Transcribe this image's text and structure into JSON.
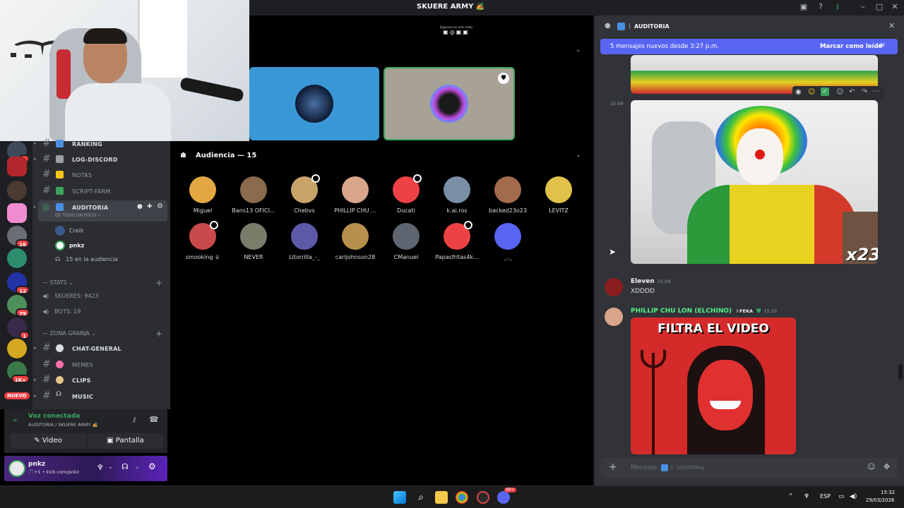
{
  "window": {
    "title": "SKUERE ARMY 🏕️"
  },
  "stage": {
    "banner_text": "Síguenos en más redes",
    "audience_label": "Audiencia — 15",
    "audience": [
      {
        "name": "Miguel",
        "color": "#e3a742",
        "muted": false
      },
      {
        "name": "Bans13 OFICI...",
        "color": "#8a6b4e",
        "muted": false
      },
      {
        "name": "Chebvs",
        "color": "#c9a46a",
        "muted": true
      },
      {
        "name": "PHILLIP CHU ...",
        "color": "#d9a58a",
        "muted": false
      },
      {
        "name": "Ducati",
        "color": "#ed4245",
        "muted": true
      },
      {
        "name": "k.ai.ros",
        "color": "#7a8fa6",
        "muted": false
      },
      {
        "name": "backed23o23",
        "color": "#a46a4e",
        "muted": false
      },
      {
        "name": "LEVITZ",
        "color": "#e1c14a",
        "muted": false
      },
      {
        "name": "smooking ♕",
        "color": "#c84a4a",
        "muted": true
      },
      {
        "name": "NEVER",
        "color": "#7c7c6a",
        "muted": false
      },
      {
        "name": "Litorrilla_-_",
        "color": "#5d5aa8",
        "muted": false
      },
      {
        "name": "carijohnson28",
        "color": "#b8904e",
        "muted": false
      },
      {
        "name": "CManuel",
        "color": "#5f6570",
        "muted": false
      },
      {
        "name": "Papasfritas4k...",
        "color": "#ed4245",
        "muted": true
      },
      {
        "name": "_._",
        "color": "#5865f2",
        "muted": false
      }
    ]
  },
  "channels": {
    "items": [
      {
        "label": "RANKING",
        "emoji_color": "#4a90e2"
      },
      {
        "label": "LOG-DISCORD",
        "emoji_color": "#9aa0a6"
      },
      {
        "label": "NOTAS",
        "emoji_color": "#f5c518"
      },
      {
        "label": "SCRIPT-FARM",
        "emoji_color": "#3ba55d"
      }
    ],
    "active_voice": {
      "label": "AUDITORIA",
      "status": "DE TODO UN POCO ~",
      "users": [
        "Creik",
        "pnkz"
      ],
      "audience_count": "15 en la audiencia"
    },
    "stats_category": "STATS",
    "stats": [
      "SKUERES: 9423",
      "BOTS: 19"
    ],
    "zona_category": "ZONA GRANJA",
    "zona": [
      "CHAT-GENERAL",
      "MEMES",
      "CLIPS",
      "MUSIC"
    ]
  },
  "servers": {
    "badges": [
      "4",
      "16",
      "12",
      "79",
      "1",
      "1K+"
    ],
    "new_label": "NUEVO"
  },
  "voice_panel": {
    "status": "Voz conectada",
    "location": "AUDITORIA / SKUERE ARMY 🏕️",
    "video_label": "Video",
    "screen_label": "Pantalla"
  },
  "user_panel": {
    "username": "pnkz",
    "status": "🎵+1 • kick.com/pnkz"
  },
  "chat": {
    "channel_name": "AUDITORIA",
    "new_messages": "5 mensajes nuevos desde 3:27 p.m.",
    "mark_read": "Marcar como leído",
    "time_1509": "15:09",
    "image_caption": "x23",
    "messages": [
      {
        "author": "Eleven",
        "time": "15:09",
        "text": "XDDDD",
        "color": "#f2f3f5"
      },
      {
        "author": "PHILLIP CHU LON (ELCHINO)",
        "tag": "FEKA",
        "time": "15:10",
        "color": "#57f287"
      }
    ],
    "meme_text": "FILTRA EL VIDEO",
    "composer_placeholder": "Mensaje",
    "composer_channel": "AUDITORIA"
  },
  "taskbar": {
    "lang": "ESP",
    "time": "15:32",
    "date": "29/03/2026",
    "discord_badge": "99+"
  }
}
